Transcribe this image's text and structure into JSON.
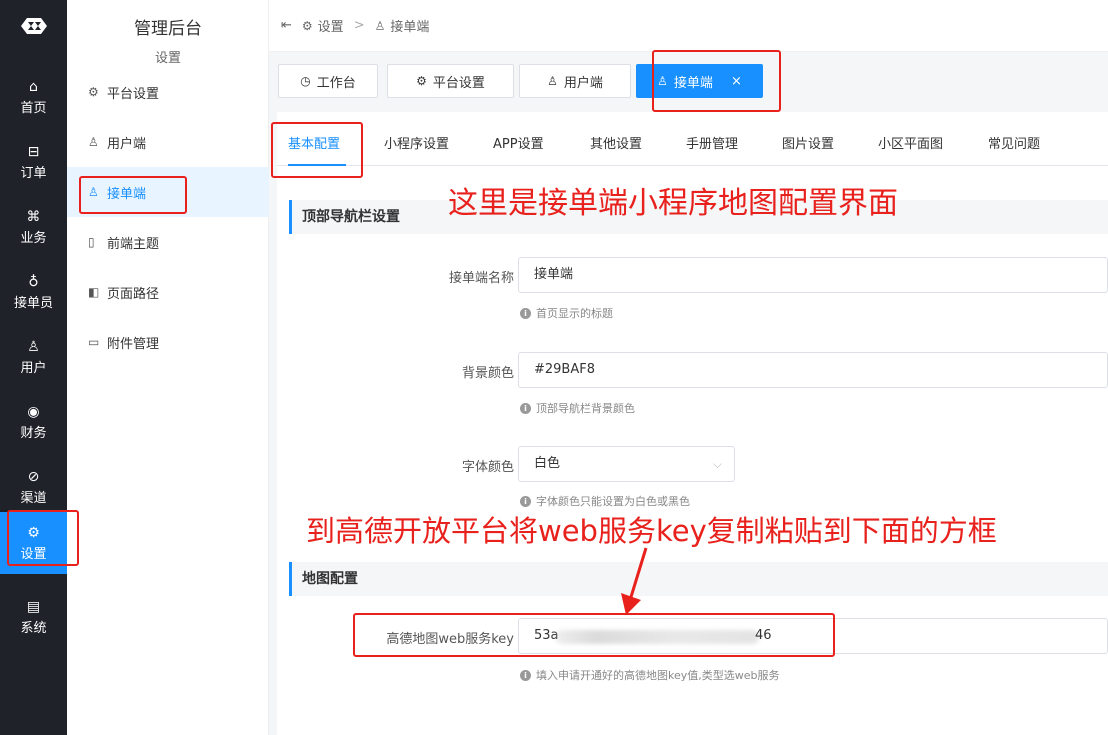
{
  "rail": {
    "items": [
      {
        "label": "首页",
        "icon": "home-icon"
      },
      {
        "label": "订单",
        "icon": "order-icon"
      },
      {
        "label": "业务",
        "icon": "business-icon"
      },
      {
        "label": "接单员",
        "icon": "bike-icon"
      },
      {
        "label": "用户",
        "icon": "user-icon"
      },
      {
        "label": "财务",
        "icon": "finance-icon"
      },
      {
        "label": "渠道",
        "icon": "channel-icon"
      },
      {
        "label": "设置",
        "icon": "settings-icon",
        "active": true
      },
      {
        "label": "系统",
        "icon": "system-icon"
      }
    ]
  },
  "sidebar": {
    "title": "管理后台",
    "subtitle": "设置",
    "items": [
      {
        "label": "平台设置",
        "icon": "gear-icon"
      },
      {
        "label": "用户端",
        "icon": "user-icon"
      },
      {
        "label": "接单端",
        "icon": "receiver-icon",
        "active": true
      },
      {
        "label": "前端主题",
        "icon": "book-icon"
      },
      {
        "label": "页面路径",
        "icon": "layout-icon"
      },
      {
        "label": "附件管理",
        "icon": "archive-icon"
      }
    ]
  },
  "breadcrumb": {
    "items": [
      "设置",
      "接单端"
    ],
    "separator": ">"
  },
  "tabs": [
    {
      "label": "工作台",
      "icon": "dashboard-icon"
    },
    {
      "label": "平台设置",
      "icon": "gear-icon"
    },
    {
      "label": "用户端",
      "icon": "user-icon"
    },
    {
      "label": "接单端",
      "icon": "receiver-icon",
      "active": true,
      "close": "×"
    }
  ],
  "subtabs": [
    "基本配置",
    "小程序设置",
    "APP设置",
    "其他设置",
    "手册管理",
    "图片设置",
    "小区平面图",
    "常见问题"
  ],
  "sections": {
    "nav": "顶部导航栏设置",
    "map": "地图配置"
  },
  "form": {
    "name_label": "接单端名称",
    "name_value": "接单端",
    "name_hint": "首页显示的标题",
    "bg_label": "背景颜色",
    "bg_value": "#29BAF8",
    "bg_hint": "顶部导航栏背景颜色",
    "font_label": "字体颜色",
    "font_value": "白色",
    "font_hint": "字体颜色只能设置为白色或黑色",
    "map_label": "高德地图web服务key",
    "map_value_start": "53a",
    "map_value_end": "46",
    "map_hint": "填入申请开通好的高德地图key值,类型选web服务"
  },
  "annotations": {
    "top": "这里是接单端小程序地图配置界面",
    "mid": "到高德开放平台将web服务key复制粘贴到下面的方框"
  },
  "colors": {
    "accent": "#1890ff",
    "rail_bg": "#20222a",
    "annotation": "#e8211d"
  }
}
